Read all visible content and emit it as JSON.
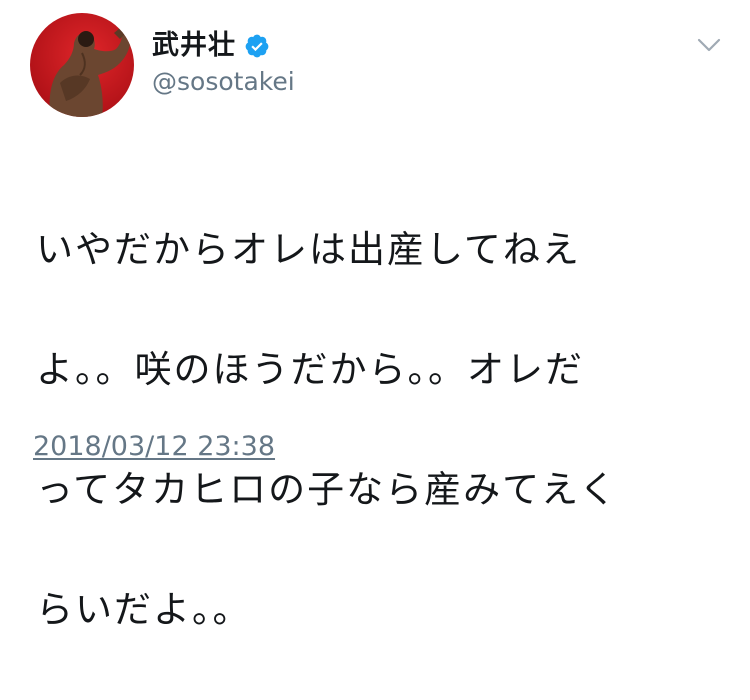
{
  "user": {
    "display_name": "武井壮",
    "handle": "@sosotakei",
    "verified": true
  },
  "icons": {
    "verified": "verified-badge-icon",
    "menu": "chevron-down-icon"
  },
  "tweet": {
    "lines": [
      "いやだからオレは出産してねえ",
      "よ。。咲のほうだから。。オレだ",
      "ってタカヒロの子なら産みてえく",
      "らいだよ。。"
    ],
    "timestamp": "2018/03/12 23:38"
  },
  "colors": {
    "text": "#14171a",
    "secondary": "#657786",
    "verified_blue": "#1da1f2",
    "avatar_red": "#c8141c"
  }
}
